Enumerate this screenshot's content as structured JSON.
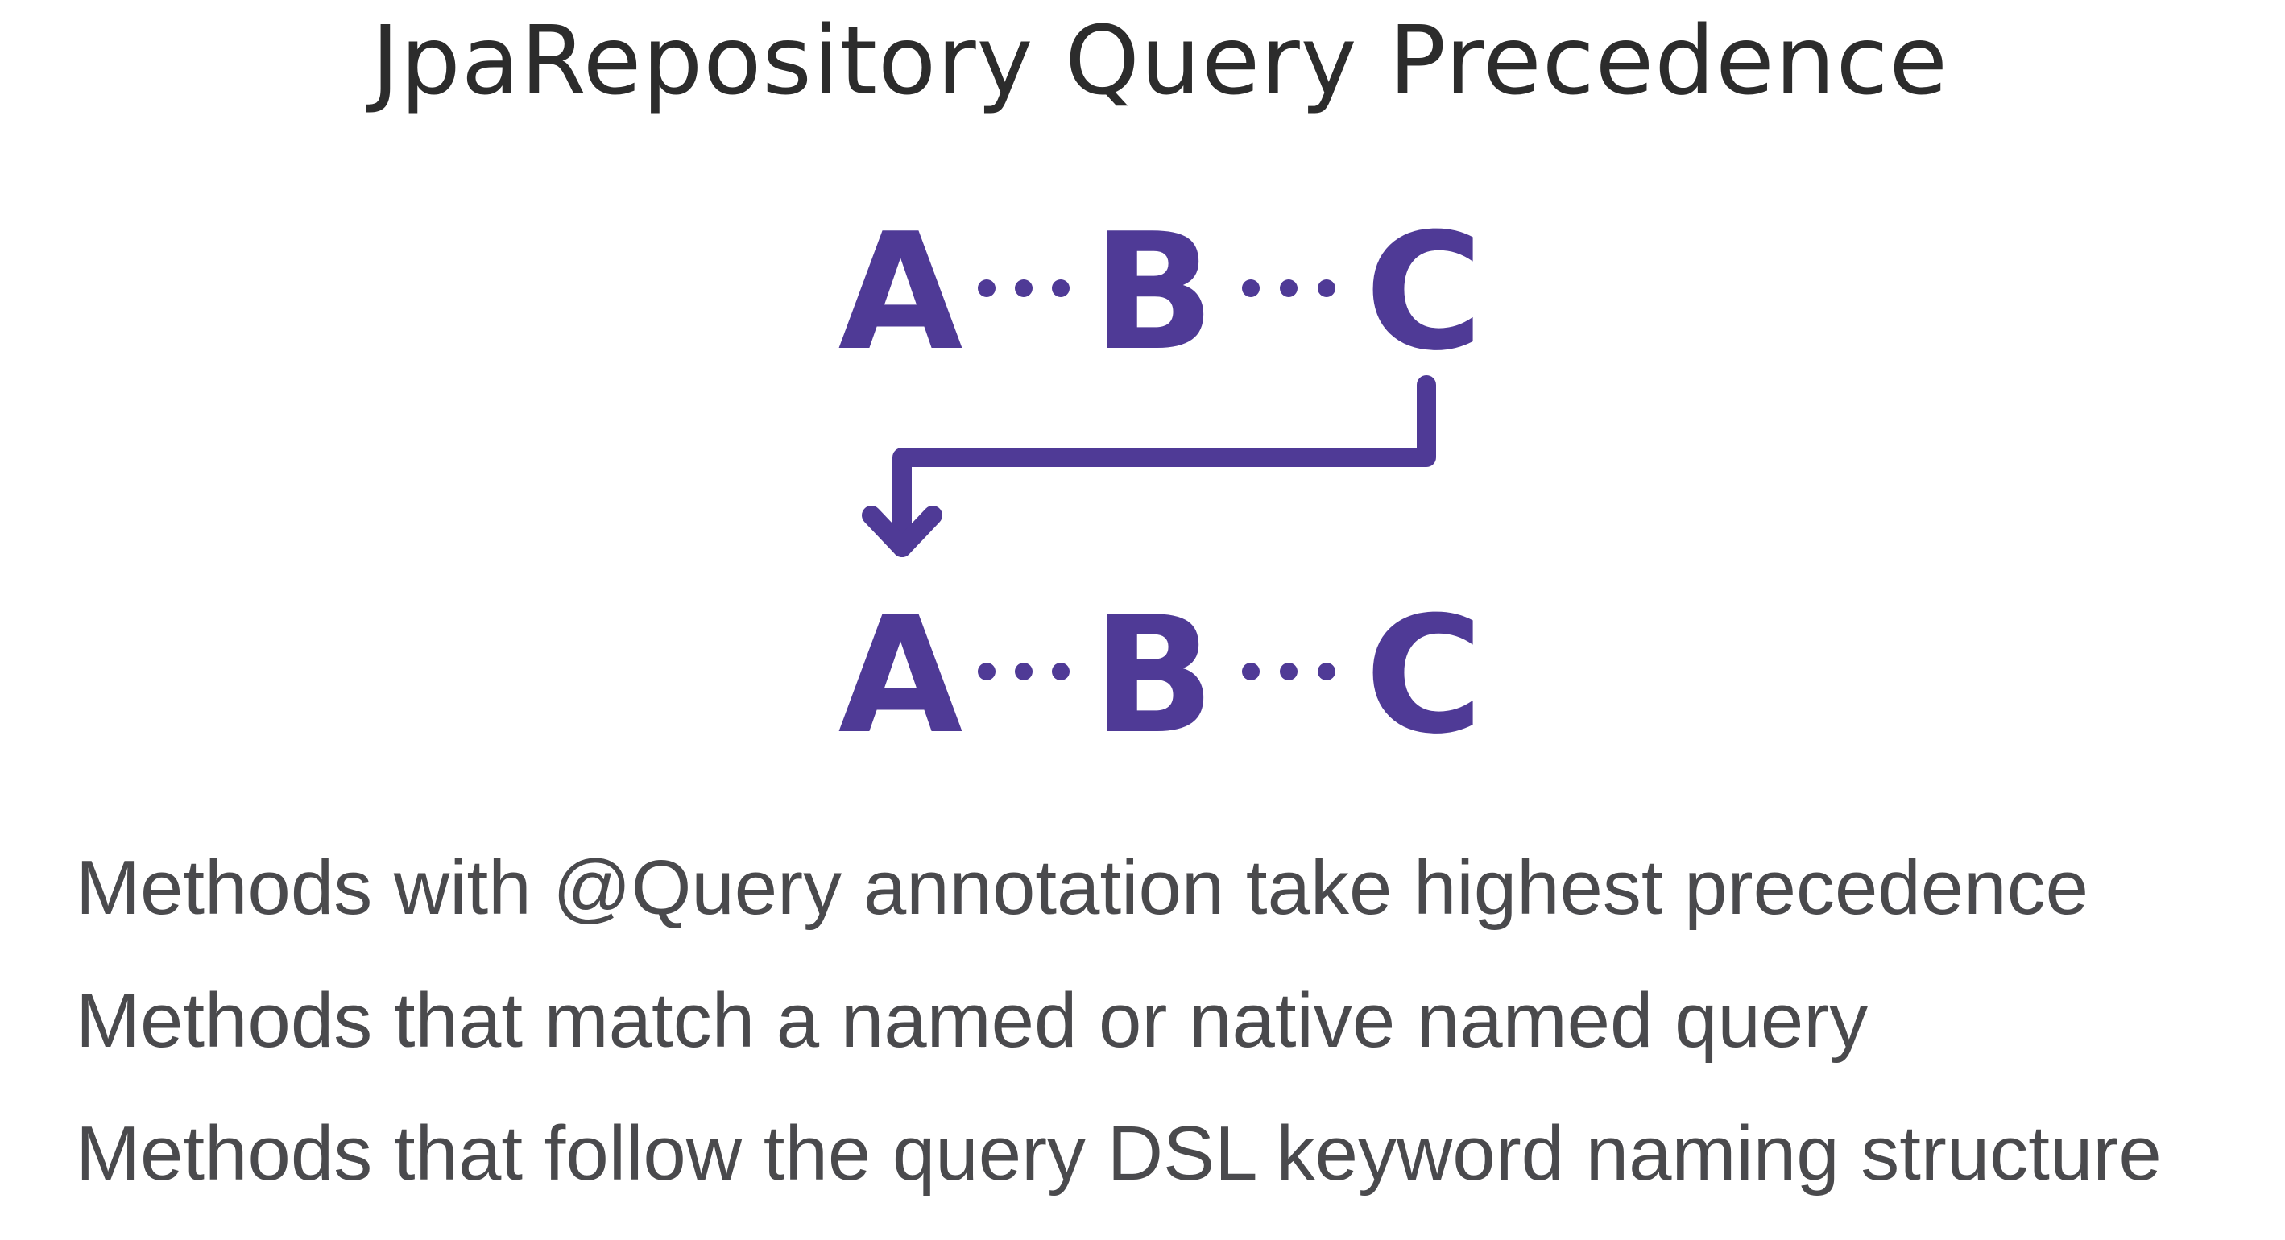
{
  "title": "JpaRepository Query Precedence",
  "diagram": {
    "top_row": [
      "A",
      "B",
      "C"
    ],
    "bottom_row": [
      "A",
      "B",
      "C"
    ],
    "accent_color": "#4f3a96",
    "connector": "arrow-from-C-to-A"
  },
  "bullets": [
    "Methods with @Query annotation take highest precedence",
    "Methods that match a named or native named query",
    "Methods that follow the query DSL keyword naming structure"
  ]
}
